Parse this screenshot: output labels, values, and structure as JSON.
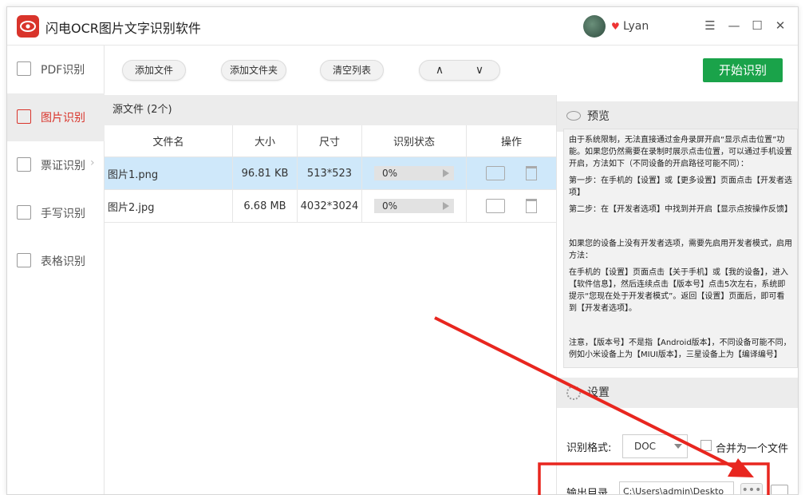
{
  "app": {
    "title": "闪电OCR图片文字识别软件",
    "username": "Lyan",
    "vip_icon": "vip-heart-icon"
  },
  "window_controls": {
    "menu": "☰",
    "minimize": "—",
    "maximize": "☐",
    "close": "✕"
  },
  "sidebar": {
    "items": [
      {
        "label": "PDF识别",
        "icon": "pdf-icon",
        "active": false
      },
      {
        "label": "图片识别",
        "icon": "image-icon",
        "active": true
      },
      {
        "label": "票证识别",
        "icon": "ticket-icon",
        "active": false,
        "chevron": "›"
      },
      {
        "label": "手写识别",
        "icon": "handwriting-icon",
        "active": false
      },
      {
        "label": "表格识别",
        "icon": "table-icon",
        "active": false
      }
    ]
  },
  "toolbar": {
    "add_file": "添加文件",
    "add_folder": "添加文件夹",
    "clear_list": "清空列表",
    "up": "∧",
    "down": "∨",
    "start": "开始识别"
  },
  "files": {
    "header": "源文件 (2个)",
    "columns": [
      "文件名",
      "大小",
      "尺寸",
      "识别状态",
      "操作"
    ],
    "rows": [
      {
        "name": "图片1.png",
        "size": "96.81 KB",
        "dims": "513*523",
        "status": "0%",
        "selected": true
      },
      {
        "name": "图片2.jpg",
        "size": "6.68 MB",
        "dims": "4032*3024",
        "status": "0%",
        "selected": false
      }
    ]
  },
  "preview": {
    "title": "预览",
    "paragraphs": [
      "由于系统限制，无法直接通过金舟录屏开启“显示点击位置”功能。如果您仍然需要在录制时展示点击位置，可以通过手机设置开启，方法如下（不同设备的开启路径可能不同）：",
      "第一步：在手机的【设置】或【更多设置】页面点击【开发者选项】",
      "第二步：在【开发者选项】中找到并开启【显示点按操作反馈】",
      "如果您的设备上没有开发者选项，需要先启用开发者模式，启用方法：",
      "在手机的【设置】页面点击【关于手机】或【我的设备】，进入【软件信息】，然后连续点击【版本号】点击5次左右，系统即提示“您现在处于开发者模式”。返回【设置】页面后，即可看到【开发者选项】。",
      "注意，【版本号】不是指【Android版本】，不同设备可能不同，例如小米设备上为【MIUI版本】，三星设备上为【编译编号】"
    ]
  },
  "settings": {
    "title": "设置",
    "format_label": "识别格式:",
    "format_value": "DOC",
    "merge_label": "合并为一个文件",
    "output_label": "输出目录",
    "output_path": "C:\\Users\\admin\\Deskto",
    "more": "•••"
  },
  "annotation": {
    "highlight_color": "#e8261f"
  }
}
